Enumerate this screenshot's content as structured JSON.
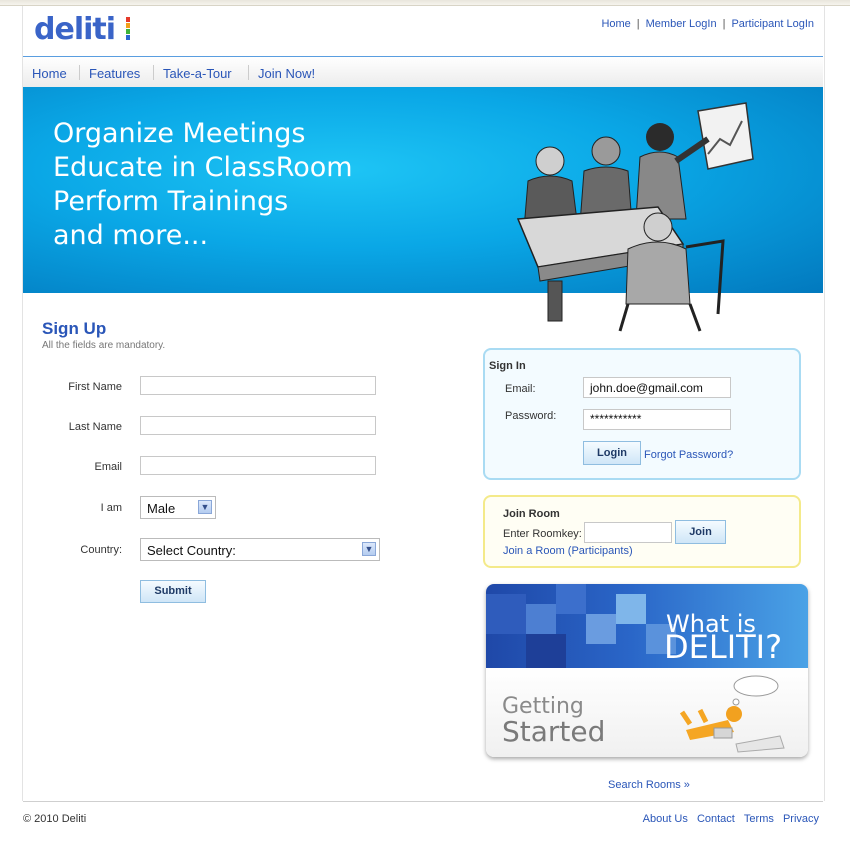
{
  "brand": {
    "logo_text": "deliti",
    "colors": {
      "accent": "#3a64c8",
      "link": "#2a56b8",
      "hero": "#0aa7e6"
    }
  },
  "top_links": [
    "Home",
    "Member LogIn",
    "Participant LogIn"
  ],
  "nav": [
    "Home",
    "Features",
    "Take-a-Tour",
    "Join Now!"
  ],
  "hero": {
    "lines": [
      "Organize Meetings",
      "Educate in ClassRoom",
      "Perform Trainings",
      "and more..."
    ]
  },
  "signup": {
    "title": "Sign Up",
    "subtitle": "All the fields are mandatory.",
    "first_name_label": "First Name",
    "last_name_label": "Last Name",
    "email_label": "Email",
    "iam_label": "I am",
    "iam_value": "Male",
    "country_label": "Country:",
    "country_value": "Select Country:",
    "submit_label": "Submit"
  },
  "signin": {
    "title": "Sign In",
    "email_label": "Email:",
    "email_value": "john.doe@gmail.com",
    "password_label": "Password:",
    "password_value": "***********",
    "login_label": "Login",
    "forgot_label": "Forgot Password?"
  },
  "join_room": {
    "title": "Join Room",
    "roomkey_label": "Enter Roomkey:",
    "join_label": "Join",
    "participants_link": "Join a Room (Participants)"
  },
  "promo": {
    "what_is": "What is",
    "brand": "DELITI?",
    "getting": "Getting",
    "started": "Started"
  },
  "search_rooms": "Search Rooms »",
  "footer": {
    "copyright": "© 2010 Deliti",
    "links": [
      "About Us",
      "Contact",
      "Terms",
      "Privacy"
    ]
  }
}
